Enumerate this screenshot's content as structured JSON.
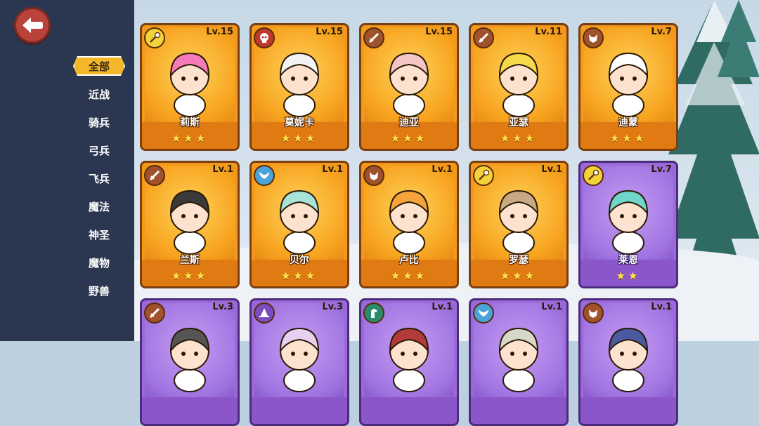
{
  "sidebar": {
    "filters": [
      {
        "label": "全部",
        "active": true
      },
      {
        "label": "近战"
      },
      {
        "label": "骑兵"
      },
      {
        "label": "弓兵"
      },
      {
        "label": "飞兵"
      },
      {
        "label": "魔法"
      },
      {
        "label": "神圣"
      },
      {
        "label": "魔物"
      },
      {
        "label": "野兽"
      }
    ]
  },
  "cards": [
    {
      "name": "莉斯",
      "level": "Lv.15",
      "stars": "★★★",
      "rarity": "gold",
      "class_icon": "staff-icon",
      "hair": "#f47ab8"
    },
    {
      "name": "莫妮卡",
      "level": "Lv.15",
      "stars": "★★★",
      "rarity": "gold",
      "class_icon": "skull-icon",
      "hair": "#f2f2f2"
    },
    {
      "name": "迪亚",
      "level": "Lv.15",
      "stars": "★★★",
      "rarity": "gold",
      "class_icon": "sword-icon",
      "hair": "#f3c5c5"
    },
    {
      "name": "亚瑟",
      "level": "Lv.11",
      "stars": "★★★",
      "rarity": "gold",
      "class_icon": "sword-icon",
      "hair": "#f5d94a"
    },
    {
      "name": "迪蒙",
      "level": "Lv.7",
      "stars": "★★★",
      "rarity": "gold",
      "class_icon": "beast-icon",
      "hair": "#ffffff"
    },
    {
      "name": "兰斯",
      "level": "Lv.1",
      "stars": "★★★",
      "rarity": "gold",
      "class_icon": "sword-icon",
      "hair": "#3a3a3a"
    },
    {
      "name": "贝尔",
      "level": "Lv.1",
      "stars": "★★★",
      "rarity": "gold",
      "class_icon": "wing-icon",
      "hair": "#a9e2d8"
    },
    {
      "name": "卢比",
      "level": "Lv.1",
      "stars": "★★★",
      "rarity": "gold",
      "class_icon": "beast-icon",
      "hair": "#f5a33a"
    },
    {
      "name": "罗瑟",
      "level": "Lv.1",
      "stars": "★★★",
      "rarity": "gold",
      "class_icon": "staff-icon",
      "hair": "#c9a983"
    },
    {
      "name": "莱恩",
      "level": "Lv.7",
      "stars": "★★",
      "rarity": "purple",
      "class_icon": "staff-icon",
      "hair": "#6fd6c9"
    },
    {
      "name": "",
      "level": "Lv.3",
      "stars": "",
      "rarity": "purple",
      "class_icon": "sword-icon",
      "hair": "#555"
    },
    {
      "name": "",
      "level": "Lv.3",
      "stars": "",
      "rarity": "purple",
      "class_icon": "hat-icon",
      "hair": "#e6d0f0"
    },
    {
      "name": "",
      "level": "Lv.1",
      "stars": "",
      "rarity": "purple",
      "class_icon": "horse-icon",
      "hair": "#b23a3a"
    },
    {
      "name": "",
      "level": "Lv.1",
      "stars": "",
      "rarity": "purple",
      "class_icon": "wing-icon",
      "hair": "#d8d8c8"
    },
    {
      "name": "",
      "level": "Lv.1",
      "stars": "",
      "rarity": "purple",
      "class_icon": "beast-icon",
      "hair": "#4a5aa0"
    }
  ]
}
